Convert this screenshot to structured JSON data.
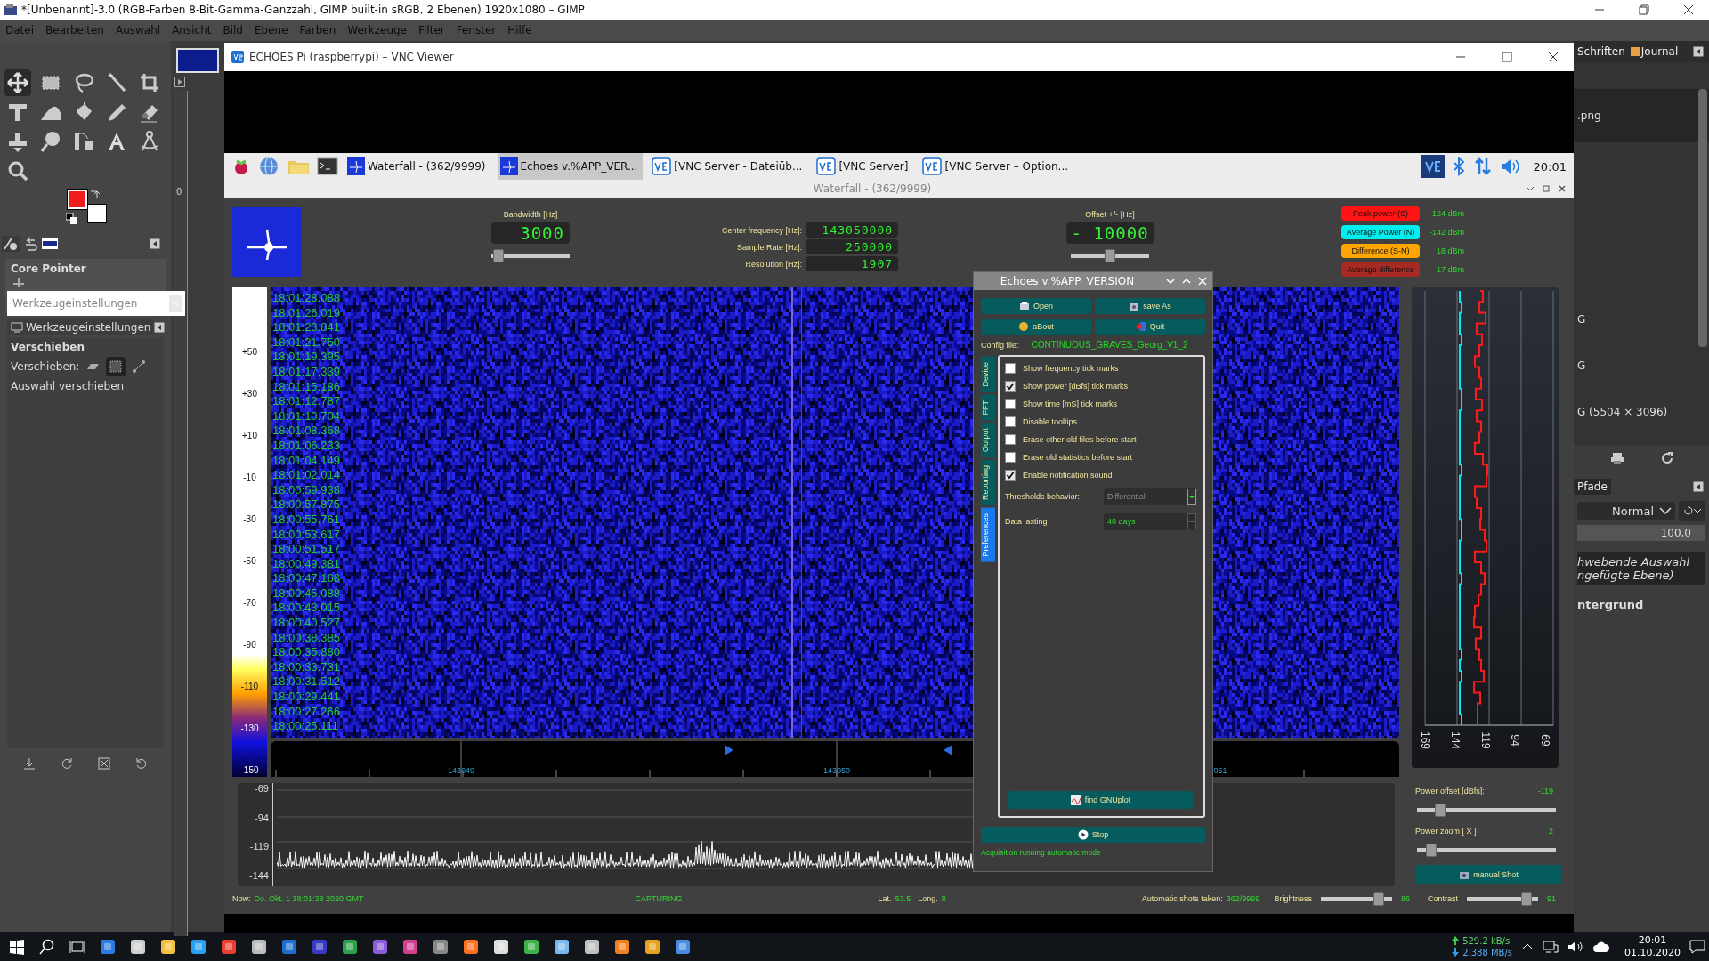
{
  "gimp": {
    "title": "*[Unbenannt]-3.0 (RGB-Farben 8-Bit-Gamma-Ganzzahl, GIMP built-in sRGB, 2 Ebenen) 1920x1080 – GIMP",
    "menu": [
      "Datei",
      "Bearbeiten",
      "Auswahl",
      "Ansicht",
      "Bild",
      "Ebene",
      "Farben",
      "Werkzeuge",
      "Filter",
      "Fenster",
      "Hilfe"
    ],
    "device": "Core Pointer",
    "tooltip": "Werkzeugeinstellungen",
    "options_tab": "Werkzeugeinstellungen",
    "tool_name": "Verschieben",
    "move_label": "Verschieben:",
    "move_hint": "Auswahl verschieben",
    "ruler_label": "0",
    "dock": {
      "tabs": [
        "Schriften",
        "Journal"
      ],
      "images": [
        {
          "label": ".png",
          "selected": true
        },
        {
          "label": "G",
          "selected": false
        },
        {
          "label": "G",
          "selected": false
        },
        {
          "label": "G (5504 × 3096)",
          "selected": false
        }
      ],
      "paths_tab": "Pfade",
      "mode": "Normal",
      "opacity": "100,0",
      "layers": [
        {
          "lines": [
            "hwebende Auswahl",
            "ngefügte Ebene)"
          ],
          "kind": "floating",
          "selected": true
        },
        {
          "lines": [
            "ntergrund"
          ],
          "kind": "layer",
          "selected": false
        }
      ]
    }
  },
  "vnc": {
    "title": "ECHOES Pi (raspberrypi) – VNC Viewer"
  },
  "pi_panel": {
    "tasks": [
      {
        "label": "Waterfall - (362/9999)",
        "kind": "echoes",
        "selected": false
      },
      {
        "label": "Echoes v.%APP_VER...",
        "kind": "echoes",
        "selected": true
      },
      {
        "label": "[VNC Server - Dateiüb...",
        "kind": "vnc",
        "selected": false
      },
      {
        "label": "[VNC Server]",
        "kind": "vnc",
        "selected": false
      },
      {
        "label": "[VNC Server – Option...",
        "kind": "vnc",
        "selected": false
      }
    ],
    "clock": "20:01"
  },
  "waterfall_window": {
    "title": "Waterfall - (362/9999)"
  },
  "echoes": {
    "bandwidth": {
      "label": "Bandwidth [Hz]",
      "value": "3000",
      "level": 0.03
    },
    "tuning": [
      {
        "label": "Center frequency [Hz]:",
        "value": "143050000"
      },
      {
        "label": "Sample Rate [Hz]:",
        "value": "250000"
      },
      {
        "label": "Resolution [Hz]:",
        "value": "1907"
      }
    ],
    "offset": {
      "label": "Offset +/- [Hz]",
      "value": "- 10000",
      "level": 0.5
    },
    "legend": [
      {
        "label": "Peak power (S)",
        "value": "-124 dBm",
        "color": "#ff1414"
      },
      {
        "label": "Average Power (N)",
        "value": "-142 dBm",
        "color": "#00f0f0"
      },
      {
        "label": "Difference (S-N)",
        "value": "18 dBm",
        "color": "#ffa500"
      },
      {
        "label": "Average difference",
        "value": "17 dBm",
        "color": "#a82a24"
      }
    ],
    "scale_labels": [
      "+50",
      "+30",
      "+10",
      "-10",
      "-30",
      "-50",
      "-70",
      "-90",
      "-110",
      "-130",
      "-150"
    ],
    "timestamps": [
      "18:01:28.088",
      "18:01:26.019",
      "18:01:23.841",
      "18:01:21.750",
      "18:01:19.395",
      "18:01:17.339",
      "18:01:15.186",
      "18:01:12.787",
      "18:01:10.704",
      "18:01:08.368",
      "18:01:06.233",
      "18:01:04.149",
      "18:01:02.014",
      "18:00:59.938",
      "18:00:57.875",
      "18:00:55.761",
      "18:00:53.617",
      "18:00:51.517",
      "18:00:49.381",
      "18:00:47.168",
      "18:00:45.088",
      "18:00:43.015",
      "18:00:40.527",
      "18:00:38.385",
      "18:00:35.880",
      "18:00:33.731",
      "18:00:31.512",
      "18:00:29.441",
      "18:00:27.266",
      "18:00:25.111"
    ],
    "freq_labels": [
      "143049",
      "143050",
      "051"
    ],
    "power_axis": [
      "169",
      "144",
      "119",
      "94",
      "69"
    ],
    "spectrum_axis": [
      "-69",
      "-94",
      "-119",
      "-144"
    ],
    "power_offset": {
      "label": "Power offset [dBfs]:",
      "value": "-119",
      "level": 0.14
    },
    "power_zoom": {
      "label": "Power zoom  [ X ]",
      "value": "2",
      "level": 0.07
    },
    "manual_shot": "manual Shot",
    "status": [
      {
        "label": "Now:",
        "value": "Do. Okt. 1 18:01:38 2020 GMT"
      },
      {
        "value": "CAPTURING"
      },
      {
        "label": "Lat.",
        "value": "53.5"
      },
      {
        "label": "Long.",
        "value": "8"
      },
      {
        "label": "Automatic shots taken:",
        "value": "362/9999"
      }
    ],
    "brightness": {
      "label": "Brightness",
      "value": "86",
      "level": 0.87
    },
    "contrast": {
      "label": "Contrast",
      "value": "91",
      "level": 0.9
    },
    "dialog": {
      "title": "Echoes v.%APP_VERSION",
      "buttons": [
        "Open",
        "save As",
        "aBout",
        "Quit"
      ],
      "config_label": "Config file:",
      "config_value": "CONTINUOUS_GRAVES_Georg_V1_2",
      "tabs": [
        {
          "label": "Device",
          "selected": false
        },
        {
          "label": "FFT",
          "selected": false
        },
        {
          "label": "Output",
          "selected": false
        },
        {
          "label": "Reporting",
          "selected": false
        },
        {
          "label": "Preferences",
          "selected": true
        }
      ],
      "options": [
        {
          "label": "Show frequency tick marks",
          "checked": false
        },
        {
          "label": "Show power [dBfs]  tick marks",
          "checked": true
        },
        {
          "label": "Show time  [mS]  tick marks",
          "checked": false
        },
        {
          "label": "Disable tooltips",
          "checked": false
        },
        {
          "label": "Erase other old files before start",
          "checked": false
        },
        {
          "label": "Erase old statistics before start",
          "checked": false
        },
        {
          "label": "Enable notification sound",
          "checked": true
        }
      ],
      "thresholds": {
        "label": "Thresholds behavior:",
        "value": "Differential",
        "disabled": true
      },
      "data_lasting": {
        "label": "Data lasting",
        "value": "40 days"
      },
      "find_button": "find GNUplot",
      "stop_button": "Stop",
      "status": "Acquisition running automatic mode"
    }
  },
  "taskbar": {
    "upload": "529.2 kB/s",
    "download": "2.388 MB/s",
    "time": "20:01",
    "date": "01.10.2020"
  }
}
